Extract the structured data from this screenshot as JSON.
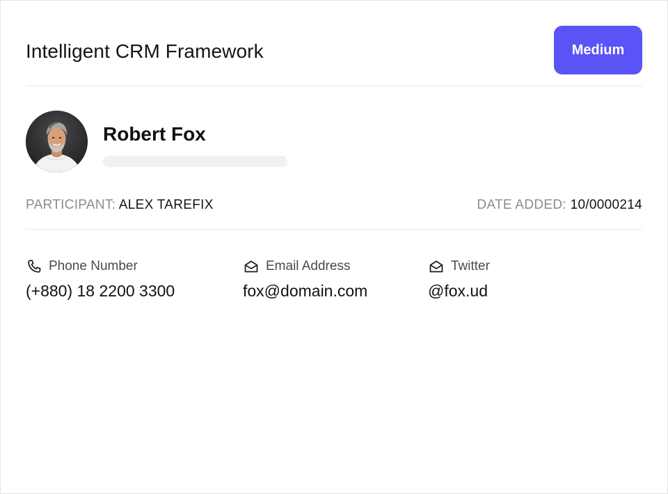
{
  "header": {
    "title": "Intelligent CRM Framework",
    "priority_label": "Medium",
    "priority_color": "#5b53f6"
  },
  "profile": {
    "name": "Robert Fox",
    "avatar_icon": "person-photo"
  },
  "meta": {
    "participant_label": "PARTICIPANT:",
    "participant_value": "ALEX TAREFIX",
    "date_label": "DATE ADDED:",
    "date_value": "10/0000214"
  },
  "contacts": {
    "phone": {
      "label": "Phone Number",
      "value": "(+880) 18 2200 3300",
      "icon": "phone-icon"
    },
    "email": {
      "label": "Email Address",
      "value": "fox@domain.com",
      "icon": "mail-open-icon"
    },
    "twitter": {
      "label": "Twitter",
      "value": "@fox.ud",
      "icon": "mail-open-icon"
    }
  }
}
